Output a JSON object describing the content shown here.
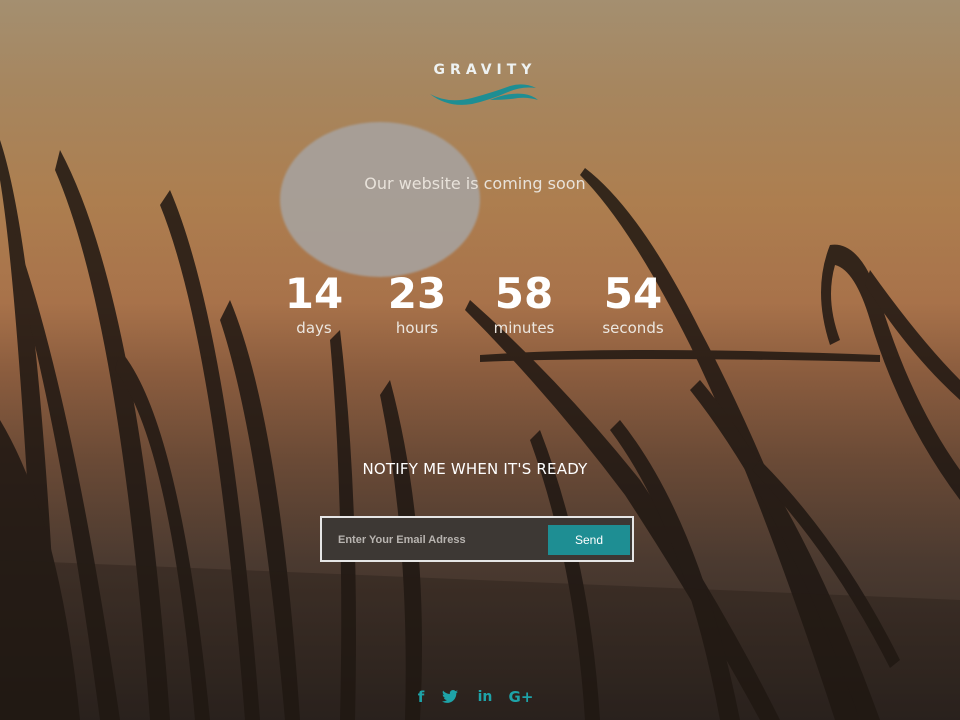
{
  "brand": {
    "name": "GRAVITY",
    "accent_color": "#1e8e93"
  },
  "hero": {
    "tagline": "Our website is coming soon"
  },
  "countdown": [
    {
      "value": "14",
      "label": "days"
    },
    {
      "value": "23",
      "label": "hours"
    },
    {
      "value": "58",
      "label": "minutes"
    },
    {
      "value": "54",
      "label": "seconds"
    }
  ],
  "notify": {
    "heading": "NOTIFY ME WHEN IT'S READY",
    "email_placeholder": "Enter Your Email Adress",
    "email_value": "",
    "send_label": "Send"
  },
  "social": [
    {
      "icon": "facebook-icon",
      "glyph": "f"
    },
    {
      "icon": "twitter-icon",
      "glyph": ""
    },
    {
      "icon": "linkedin-icon",
      "glyph": "in"
    },
    {
      "icon": "google-plus-icon",
      "glyph": "G+"
    }
  ]
}
